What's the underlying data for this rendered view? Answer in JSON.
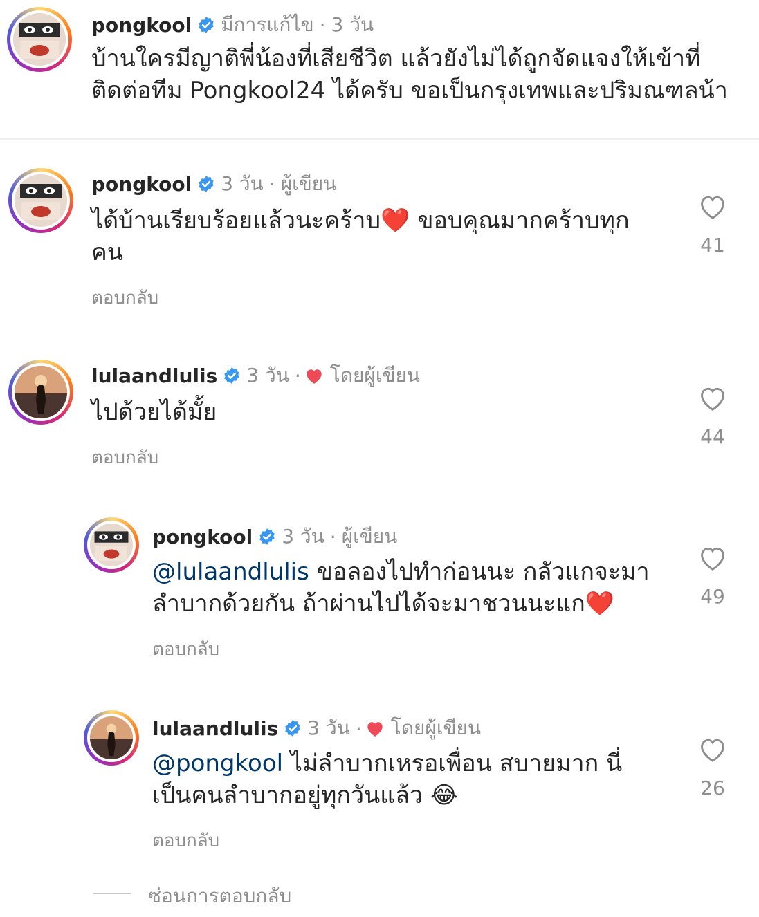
{
  "post": {
    "username": "pongkool",
    "edited": "มีการแก้ไข",
    "time": "3 วัน",
    "line1": "บ้านใครมีญาติพี่น้องที่เสียชีวิต แล้วยังไม่ได้ถูกจัดแจงให้เข้าที่",
    "line2": "ติดต่อทีม Pongkool24 ได้ครับ ขอเป็นกรุงเทพและปริมณฑลน้า"
  },
  "comments": [
    {
      "username": "pongkool",
      "time": "3 วัน",
      "tag": "ผู้เขียน",
      "line1": "ได้บ้านเรียบร้อยแล้วนะคร้าบ❤️ ขอบคุณมากคร้าบทุก",
      "line2": "คน",
      "reply": "ตอบกลับ",
      "likes": "41"
    },
    {
      "username": "lulaandlulis",
      "time": "3 วัน",
      "tag": "โดยผู้เขียน",
      "line1": "ไปด้วยได้มั้ย",
      "reply": "ตอบกลับ",
      "likes": "44"
    },
    {
      "username": "pongkool",
      "time": "3 วัน",
      "tag": "ผู้เขียน",
      "mention": "@lulaandlulis",
      "line1": " ขอลองไปทำก่อนนะ กลัวแกจะมา",
      "line2": "ลำบากด้วยกัน ถ้าผ่านไปได้จะมาชวนนะแก❤️",
      "reply": "ตอบกลับ",
      "likes": "49"
    },
    {
      "username": "lulaandlulis",
      "time": "3 วัน",
      "tag": "โดยผู้เขียน",
      "mention": "@pongkool",
      "line1": " ไม่ลำบากเหรอเพื่อน สบายมาก นี่",
      "line2": "เป็นคนลำบากอยู่ทุกวันแล้ว 😂",
      "reply": "ตอบกลับ",
      "likes": "26"
    }
  ],
  "hide_replies": "ซ่อนการตอบกลับ",
  "colors": {
    "verified": "#3897f0",
    "heart": "#ed4956",
    "mention": "#00376b",
    "muted": "#8e8e8e"
  }
}
